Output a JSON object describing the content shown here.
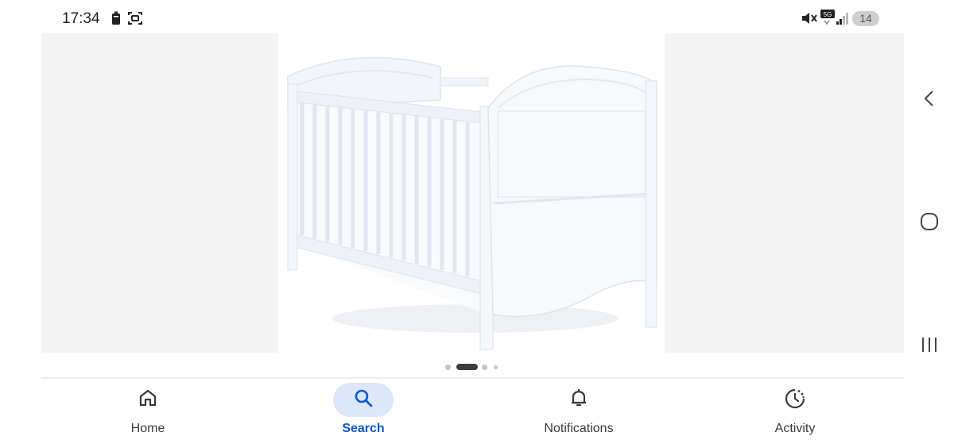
{
  "status_bar": {
    "time": "17:34",
    "battery_level": "14",
    "icons": [
      "battery-icon",
      "screenshot-icon",
      "mute-icon",
      "signal-5g-icon",
      "signal-bars-icon"
    ]
  },
  "carousel": {
    "image": "white-cot-bed-product-photo",
    "slide_count": 4,
    "active_slide": 2
  },
  "bottom_nav": {
    "items": [
      {
        "label": "Home",
        "icon": "home-icon",
        "active": false
      },
      {
        "label": "Search",
        "icon": "search-icon",
        "active": true
      },
      {
        "label": "Notifications",
        "icon": "bell-icon",
        "active": false
      },
      {
        "label": "Activity",
        "icon": "activity-icon",
        "active": false
      }
    ]
  },
  "system_nav": {
    "buttons": [
      "back-icon",
      "home-circle-icon",
      "recent-apps-icon"
    ]
  },
  "colors": {
    "accent": "#0b57d0",
    "active_pill": "#dde7fb",
    "side_panel": "#f4f4f4"
  }
}
